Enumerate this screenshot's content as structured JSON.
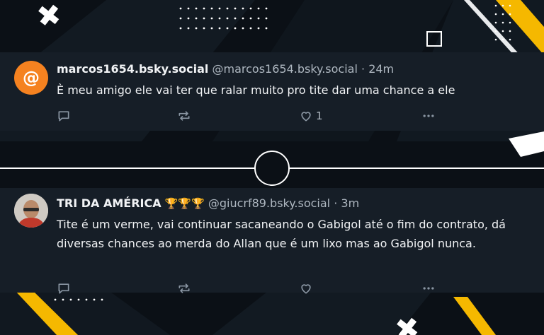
{
  "posts": [
    {
      "display_name": "marcos1654.bsky.social",
      "handle": "@marcos1654.bsky.social",
      "separator": "·",
      "time": "24m",
      "avatar_glyph": "@",
      "text": "È meu amigo ele vai ter que ralar muito pro tite dar uma chance a ele",
      "like_count": "1",
      "icons": [
        "reply-icon",
        "repost-icon",
        "like-icon",
        "more-icon"
      ]
    },
    {
      "display_name": "TRI DA AMÉRICA",
      "trophies": "🏆🏆🏆",
      "handle": "@giucrf89.bsky.social",
      "separator": "·",
      "time": "3m",
      "text": "Tite é um verme, vai continuar sacaneando o Gabigol até o fim do contrato, dá diversas chances ao merda do Allan que é um lixo mas ao Gabigol nunca.",
      "icons": [
        "reply-icon",
        "repost-icon",
        "like-icon",
        "more-icon"
      ]
    }
  ],
  "colors": {
    "background": "#0b1016",
    "card": "#161e27",
    "accent_yellow": "#f5b800",
    "avatar_orange": "#f58220",
    "muted_text": "#aeb7c0"
  }
}
